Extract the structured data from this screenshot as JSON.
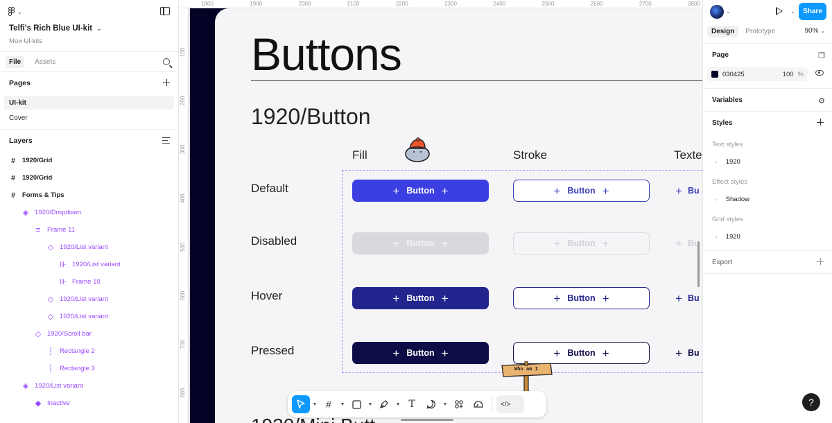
{
  "app": {
    "file_title": "Telfi's Rich Blue UI-kit",
    "file_subtitle": "Мои UI-kits"
  },
  "left_panel": {
    "tabs": [
      "File",
      "Assets"
    ],
    "pages_heading": "Pages",
    "pages": [
      "UI-kit",
      "Cover"
    ],
    "layers_heading": "Layers",
    "layers": [
      {
        "name": "1920/Grid",
        "kind": "frame",
        "depth": 0
      },
      {
        "name": "1920/Grid",
        "kind": "frame",
        "depth": 0
      },
      {
        "name": "Forms & Tips",
        "kind": "frame",
        "depth": 0
      },
      {
        "name": "1920/Dropdown",
        "kind": "component-set",
        "depth": 1
      },
      {
        "name": "Frame 11",
        "kind": "autolayout",
        "depth": 2
      },
      {
        "name": "1920/List variant",
        "kind": "instance",
        "depth": 3
      },
      {
        "name": "1920/List variant",
        "kind": "autolayout-comp",
        "depth": 4
      },
      {
        "name": "Frame 10",
        "kind": "autolayout-comp",
        "depth": 4
      },
      {
        "name": "1920/List variant",
        "kind": "instance",
        "depth": 3
      },
      {
        "name": "1920/List variant",
        "kind": "instance",
        "depth": 3
      },
      {
        "name": "1920/Scroll bar",
        "kind": "instance",
        "depth": 2
      },
      {
        "name": "Rectangle 2",
        "kind": "rect",
        "depth": 3
      },
      {
        "name": "Rectangle 3",
        "kind": "rect",
        "depth": 3
      },
      {
        "name": "1920/List variant",
        "kind": "component-set",
        "depth": 1
      },
      {
        "name": "Inactive",
        "kind": "component",
        "depth": 2
      }
    ]
  },
  "canvas": {
    "ruler_top": [
      "1800",
      "1900",
      "2000",
      "2100",
      "2200",
      "2300",
      "2400",
      "2500",
      "2600",
      "2700",
      "2800"
    ],
    "ruler_left": [
      "100",
      "200",
      "300",
      "400",
      "500",
      "600",
      "700",
      "800"
    ],
    "title": "Buttons",
    "subtitle": "1920/Button",
    "columns": [
      "Fill",
      "Stroke",
      "Texted"
    ],
    "rows": [
      {
        "label": "Default",
        "fill": "#3b3ee0",
        "stroke_color": "#3b3eb5",
        "text_color": "#3b3eb5"
      },
      {
        "label": "Disabled",
        "fill": "#d9d9dd",
        "stroke_color": "#d9d9dd",
        "text_color": "#d0d0d6"
      },
      {
        "label": "Hover",
        "fill": "#23258f",
        "stroke_color": "#23258f",
        "text_color": "#23258f"
      },
      {
        "label": "Pressed",
        "fill": "#0d0c47",
        "stroke_color": "#0d0c47",
        "text_color": "#0d0c47"
      }
    ],
    "button_label": "Button",
    "text_button_label": "Bu",
    "sign_text": "Who am I",
    "bottom_peek": "1920/Mini Butt"
  },
  "toolbar": {
    "tools": [
      "move-tool",
      "frame-tool",
      "shape-tool",
      "pen-tool",
      "text-tool",
      "comment-tool",
      "actions-tool",
      "plugins-tool",
      "dev-mode"
    ]
  },
  "right_panel": {
    "share_label": "Share",
    "tabs": [
      "Design",
      "Prototype"
    ],
    "zoom": "90%",
    "page_heading": "Page",
    "page_color": "030425",
    "page_opacity": "100",
    "page_opacity_unit": "%",
    "variables_heading": "Variables",
    "styles_heading": "Styles",
    "text_styles_label": "Text styles",
    "text_styles": [
      "1920"
    ],
    "effect_styles_label": "Effect styles",
    "effect_styles": [
      "Shadow"
    ],
    "grid_styles_label": "Grid styles",
    "grid_styles": [
      "1920"
    ],
    "export_heading": "Export"
  },
  "help_label": "?"
}
